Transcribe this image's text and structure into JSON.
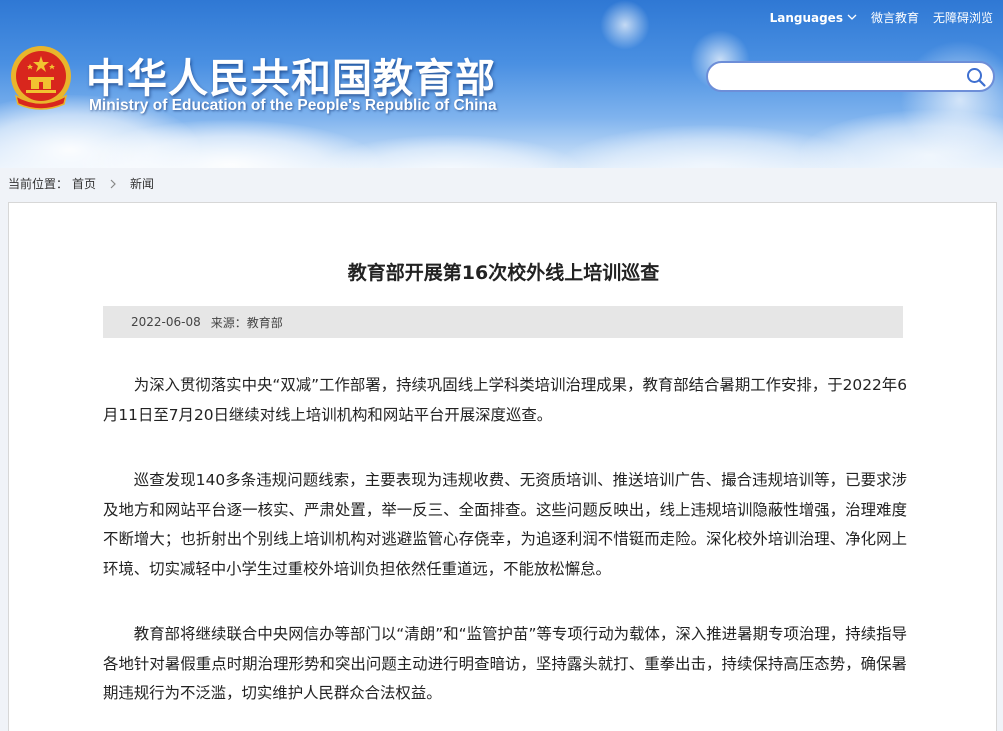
{
  "header": {
    "title_cn": "中华人民共和国教育部",
    "title_en": "Ministry of Education of the People's Republic of China",
    "top_links": {
      "languages": "Languages",
      "weiyan": "微言教育",
      "accessibility": "无障碍浏览"
    },
    "search": {
      "value": "",
      "placeholder": ""
    }
  },
  "breadcrumb": {
    "prefix": "当前位置：",
    "home": "首页",
    "current": "新闻"
  },
  "article": {
    "title": "教育部开展第16次校外线上培训巡查",
    "date": "2022-06-08",
    "source": "来源：教育部",
    "paragraphs": [
      "为深入贯彻落实中央“双减”工作部署，持续巩固线上学科类培训治理成果，教育部结合暑期工作安排，于2022年6月11日至7月20日继续对线上培训机构和网站平台开展深度巡查。",
      "巡查发现140多条违规问题线索，主要表现为违规收费、无资质培训、推送培训广告、撮合违规培训等，已要求涉及地方和网站平台逐一核实、严肃处置，举一反三、全面排查。这些问题反映出，线上违规培训隐蔽性增强，治理难度不断增大；也折射出个别线上培训机构对逃避监管心存侥幸，为追逐利润不惜铤而走险。深化校外培训治理、净化网上环境、切实减轻中小学生过重校外培训负担依然任重道远，不能放松懈怠。",
      "教育部将继续联合中央网信办等部门以“清朗”和“监管护苗”等专项行动为载体，深入推进暑期专项治理，持续指导各地针对暑假重点时期治理形势和突出问题主动进行明查暗访，坚持露头就打、重拳出击，持续保持高压态势，确保暑期违规行为不泛滥，切实维护人民群众合法权益。"
    ]
  },
  "colors": {
    "header_blue": "#3b82dc",
    "emblem_red": "#d8261d",
    "emblem_gold": "#f2c230",
    "meta_bar": "#e6e6e6"
  },
  "icons": {
    "emblem": "national-emblem-icon",
    "search": "search-icon",
    "chevron": "chevron-down-icon",
    "breadcrumb_sep": "chevron-right-icon"
  }
}
